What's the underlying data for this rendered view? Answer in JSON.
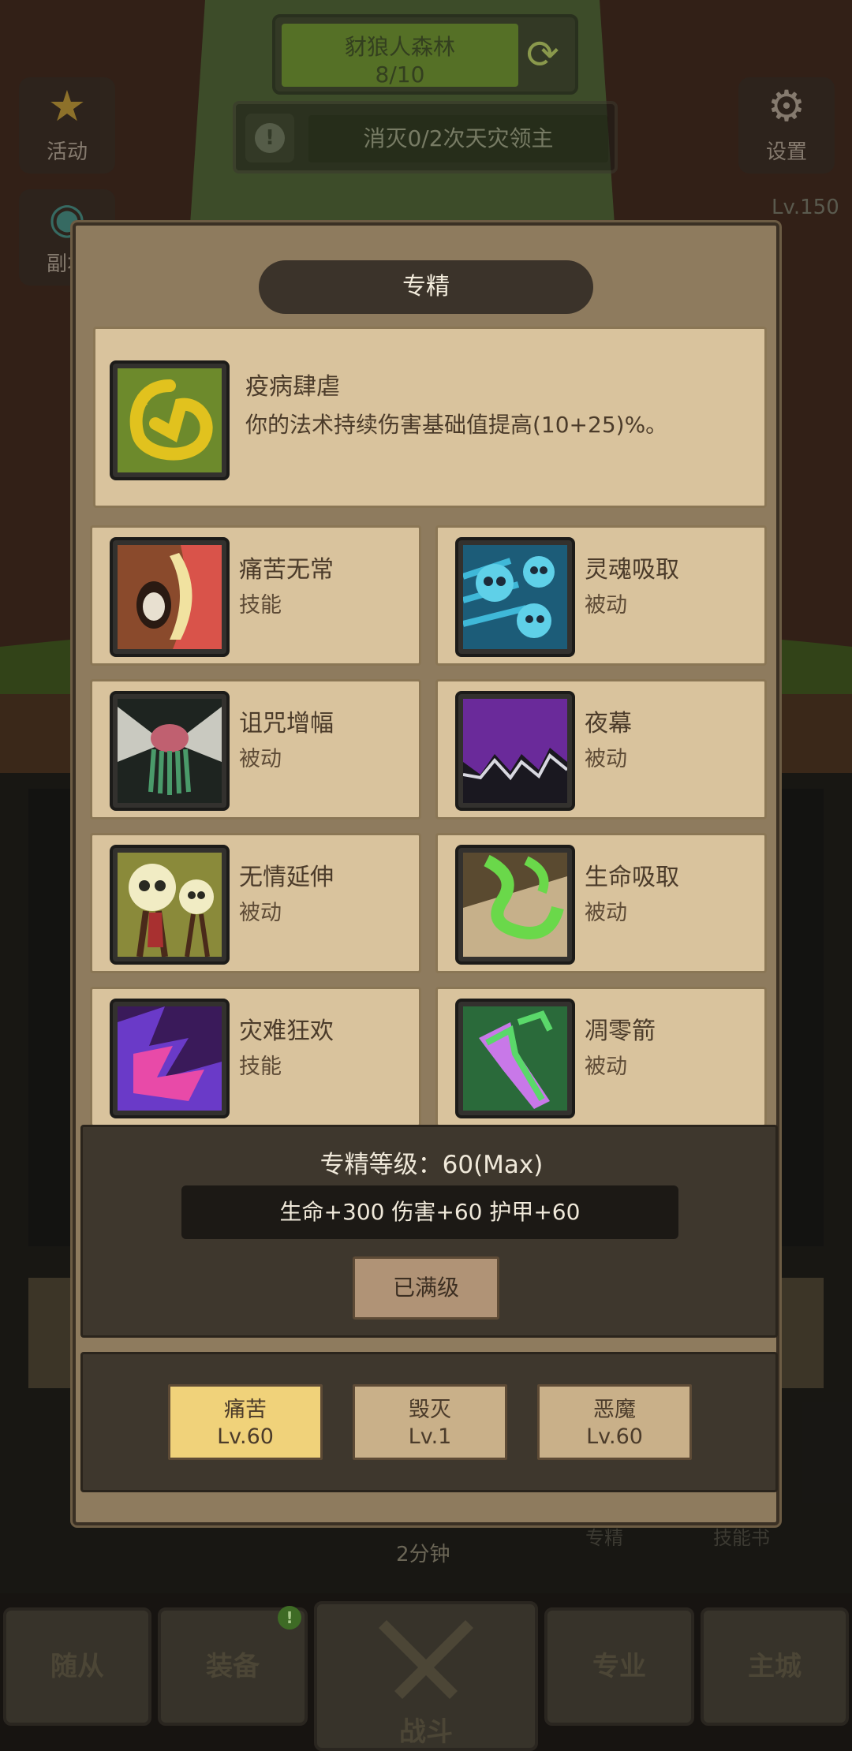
{
  "hud": {
    "zone_name": "豺狼人森林",
    "zone_progress": "8/10",
    "quest_text": "消灭0/2次天灾领主",
    "activity_label": "活动",
    "dungeon_label": "副本",
    "settings_label": "设置",
    "level_text": "Lv.150",
    "timer_text": "2分钟",
    "spec_shortcut_label": "专精",
    "skillbook_label": "技能书"
  },
  "modal": {
    "title": "专精",
    "featured": {
      "name": "疫病肆虐",
      "description": "你的法术持续伤害基础值提高(10+25)%。",
      "icon": "plague-swirl-icon"
    },
    "specs": [
      {
        "name": "痛苦无常",
        "type": "技能",
        "icon": "screaming-face-icon"
      },
      {
        "name": "灵魂吸取",
        "type": "被动",
        "icon": "skulls-icon"
      },
      {
        "name": "诅咒增幅",
        "type": "被动",
        "icon": "curse-moth-icon"
      },
      {
        "name": "夜幕",
        "type": "被动",
        "icon": "nightfall-icon"
      },
      {
        "name": "无情延伸",
        "type": "被动",
        "icon": "twin-skulls-icon"
      },
      {
        "name": "生命吸取",
        "type": "被动",
        "icon": "life-drain-icon"
      },
      {
        "name": "灾难狂欢",
        "type": "技能",
        "icon": "chaos-revel-icon"
      },
      {
        "name": "凋零箭",
        "type": "被动",
        "icon": "wither-bolt-icon"
      }
    ],
    "spec_level_text": "专精等级：60(Max)",
    "bonus_text": "生命+300  伤害+60  护甲+60",
    "maxed_button": "已满级",
    "trees": [
      {
        "name": "痛苦",
        "level": "Lv.60",
        "active": true
      },
      {
        "name": "毁灭",
        "level": "Lv.1",
        "active": false
      },
      {
        "name": "恶魔",
        "level": "Lv.60",
        "active": false
      }
    ]
  },
  "nav": {
    "followers": "随从",
    "equipment": "装备",
    "battle": "战斗",
    "profession": "专业",
    "main_city": "主城",
    "notification_badge": "!"
  },
  "colors": {
    "card_bg": "#d9c39d",
    "modal_bg": "#8e7b5e",
    "active_tree": "#f0d27a",
    "text_dark": "#4b3b2a"
  }
}
